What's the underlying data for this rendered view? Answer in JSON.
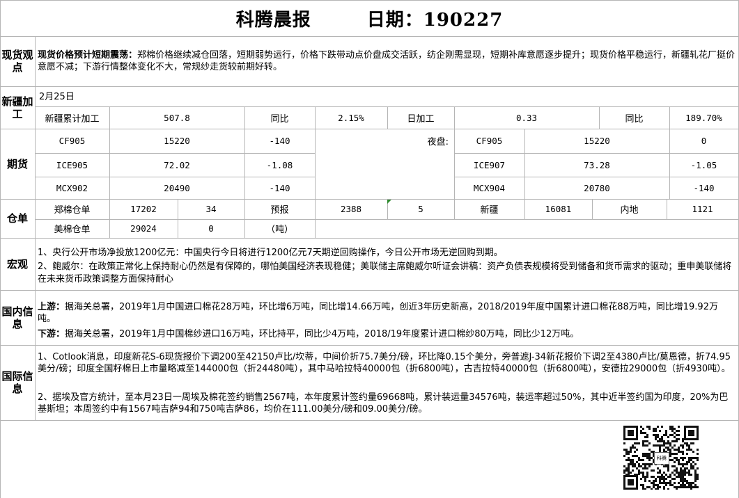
{
  "header": {
    "title": "科腾晨报",
    "date_label": "日期：190227"
  },
  "spot": {
    "label": "现货观点",
    "headline": "现货价格预计短期震荡：",
    "text": "郑棉价格继续减仓回落，短期弱势运行，价格下跌带动点价盘成交活跃，纺企刚需显现，短期补库意愿逐步提升；现货价格平稳运行，新疆轧花厂挺价意愿不减；下游行情整体变化不大，常规纱走货较前期好转。"
  },
  "xinjiang": {
    "label": "新疆加工",
    "date": "2月25日",
    "cum_label": "新疆累计加工",
    "cum_value": "507.8",
    "yoy_label1": "同比",
    "yoy_value1": "2.15%",
    "daily_label": "日加工",
    "daily_value": "0.33",
    "yoy_label2": "同比",
    "yoy_value2": "189.70%"
  },
  "futures": {
    "label": "期货",
    "night_label": "夜盘:",
    "rows": [
      {
        "c1": "CF905",
        "v1": "15220",
        "d1": "-140",
        "c2": "CF905",
        "v2": "15220",
        "d2": "0"
      },
      {
        "c1": "ICE905",
        "v1": "72.02",
        "d1": "-1.08",
        "c2": "ICE907",
        "v2": "73.28",
        "d2": "-1.05"
      },
      {
        "c1": "MCX902",
        "v1": "20490",
        "d1": "-140",
        "c2": "MCX904",
        "v2": "20780",
        "d2": "-140"
      }
    ]
  },
  "warehouse": {
    "label": "仓单",
    "r1": {
      "name": "郑棉仓单",
      "v1": "17202",
      "v2": "34",
      "forecast_label": "预报",
      "forecast_value": "2388",
      "forecast_delta": "5",
      "xj_label": "新疆",
      "xj_value": "16081",
      "nd_label": "内地",
      "nd_value": "1121"
    },
    "r2": {
      "name": "美棉仓单",
      "v1": "29024",
      "v2": "0",
      "unit": "（吨）"
    }
  },
  "macro": {
    "label": "宏观",
    "p1": "1、央行公开市场净投放1200亿元：中国央行今日将进行1200亿元7天期逆回购操作，今日公开市场无逆回购到期。",
    "p2": "2、鲍威尔：在政策正常化上保持耐心仍然是有保障的，哪怕美国经济表现稳健；美联储主席鲍威尔听证会讲稿：资产负债表规模将受到储备和货币需求的驱动；重申美联储将在未来货币政策调整方面保持耐心"
  },
  "domestic": {
    "label": "国内信息",
    "up_label": "上游：",
    "up_text": "据海关总署，2019年1月中国进口棉花28万吨，环比增6万吨，同比增14.66万吨，创近3年历史新高，2018/2019年度中国累计进口棉花88万吨，同比增19.92万吨。",
    "down_label": "下游：",
    "down_text": "据海关总署，2019年1月中国棉纱进口16万吨，环比持平，同比少4万吨，2018/19年度累计进口棉纱80万吨，同比少12万吨。"
  },
  "intl": {
    "label": "国际信息",
    "p1": "1、Cotlook消息，印度新花S-6现货报价下调200至42150卢比/坎蒂，中间价折75.7美分/磅，环比降0.15个美分，旁普遮J-34新花报价下调2至4380卢比/莫恩德，折74.95美分/磅；印度全国籽棉日上市量略减至144000包（折24480吨），其中马哈拉特40000包（折6800吨），古吉拉特40000包（折6800吨），安德拉29000包（折4930吨）。",
    "p2": "2、据埃及官方统计，至本月23日一周埃及棉花签约销售2567吨，本年度累计签约量69668吨，累计装运量34576吨，装运率超过50%，其中近半签约国为印度，20%为巴基斯坦；本周签约中有1567吨吉萨94和750吨吉萨86，均价在111.00美分/磅和09.00美分/磅。"
  },
  "qr": {
    "caption": "科腾"
  }
}
